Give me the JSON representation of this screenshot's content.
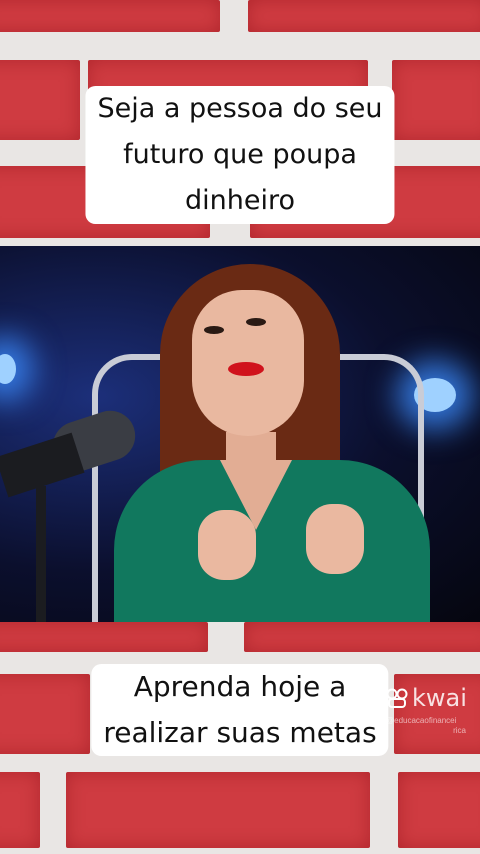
{
  "captions": {
    "top": [
      "Seja a pessoa do seu",
      "futuro que poupa",
      "dinheiro"
    ],
    "bottom": [
      "Aprenda hoje a",
      "realizar suas metas"
    ]
  },
  "watermark": {
    "brand": "kwai",
    "handle_line1": "@educacaofinancei",
    "handle_line2": "rica",
    "icon": "kwai-logo-icon"
  },
  "colors": {
    "brick": "#cf3b41",
    "mortar": "#e9e6e4",
    "dress": "#11785e",
    "background_light": "#1c2f7a"
  }
}
